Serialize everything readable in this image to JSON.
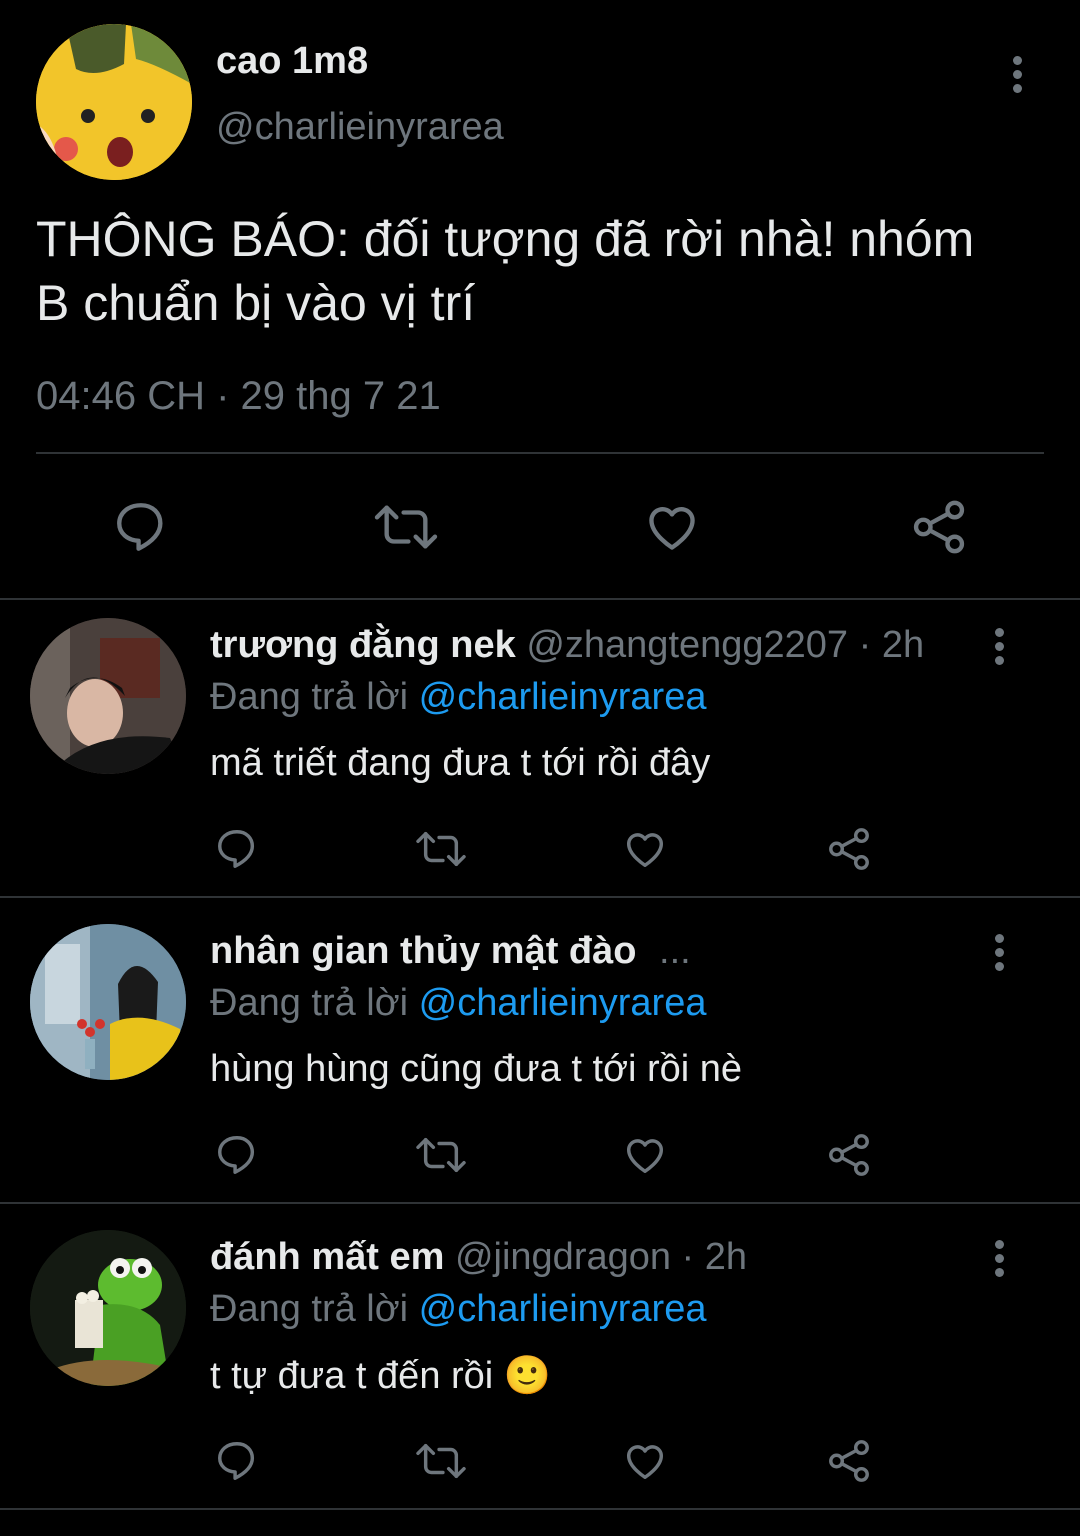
{
  "main_tweet": {
    "display_name": "cao 1m8",
    "handle": "@charlieinyrarea",
    "text_line1": "THÔNG BÁO: đối tượng đã rời nhà! nhóm",
    "text_line2": "B chuẩn bị vào vị trí",
    "timestamp": "04:46 CH · 29 thg 7 21",
    "avatar_icon": "pikachu-avatar"
  },
  "reply_prefix": "Đang trả lời",
  "replies": [
    {
      "display_name": "trương đằng nek",
      "handle": "@zhangtengg2207 · 2h",
      "reply_to": "@charlieinyrarea",
      "text": "mã triết đang đưa t tới rồi đây",
      "avatar_icon": "person-avatar"
    },
    {
      "display_name": "nhân gian thủy mật đào",
      "handle": "...",
      "reply_to": "@charlieinyrarea",
      "text": "hùng hùng cũng đưa t tới rồi nè",
      "avatar_icon": "girl-avatar"
    },
    {
      "display_name": "đánh mất em",
      "handle": "@jingdragon · 2h",
      "reply_to": "@charlieinyrarea",
      "text": "t tự đưa t đến rồi 🙂",
      "avatar_icon": "kermit-avatar"
    }
  ],
  "colors": {
    "background": "#000000",
    "text": "#e7e9ea",
    "muted": "#6e767d",
    "accent": "#1d9bf0"
  }
}
